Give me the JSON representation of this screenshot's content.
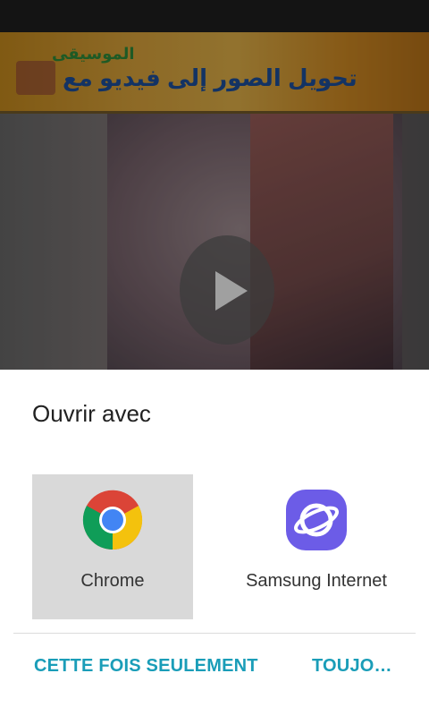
{
  "background_app": {
    "banner_subtitle": "الموسيقى",
    "banner_title": "تحويل الصور إلى فيديو مع"
  },
  "dialog": {
    "title": "Ouvrir avec",
    "apps": [
      {
        "label": "Chrome",
        "icon": "chrome-icon",
        "selected": true
      },
      {
        "label": "Samsung Internet",
        "icon": "samsung-internet-icon",
        "selected": false
      }
    ],
    "actions": {
      "once": "CETTE FOIS SEULEMENT",
      "always": "TOUJO…"
    }
  },
  "colors": {
    "accent": "#1a9db8",
    "selected_bg": "#d9d9d9",
    "samsung_internet": "#6c5ce7"
  }
}
